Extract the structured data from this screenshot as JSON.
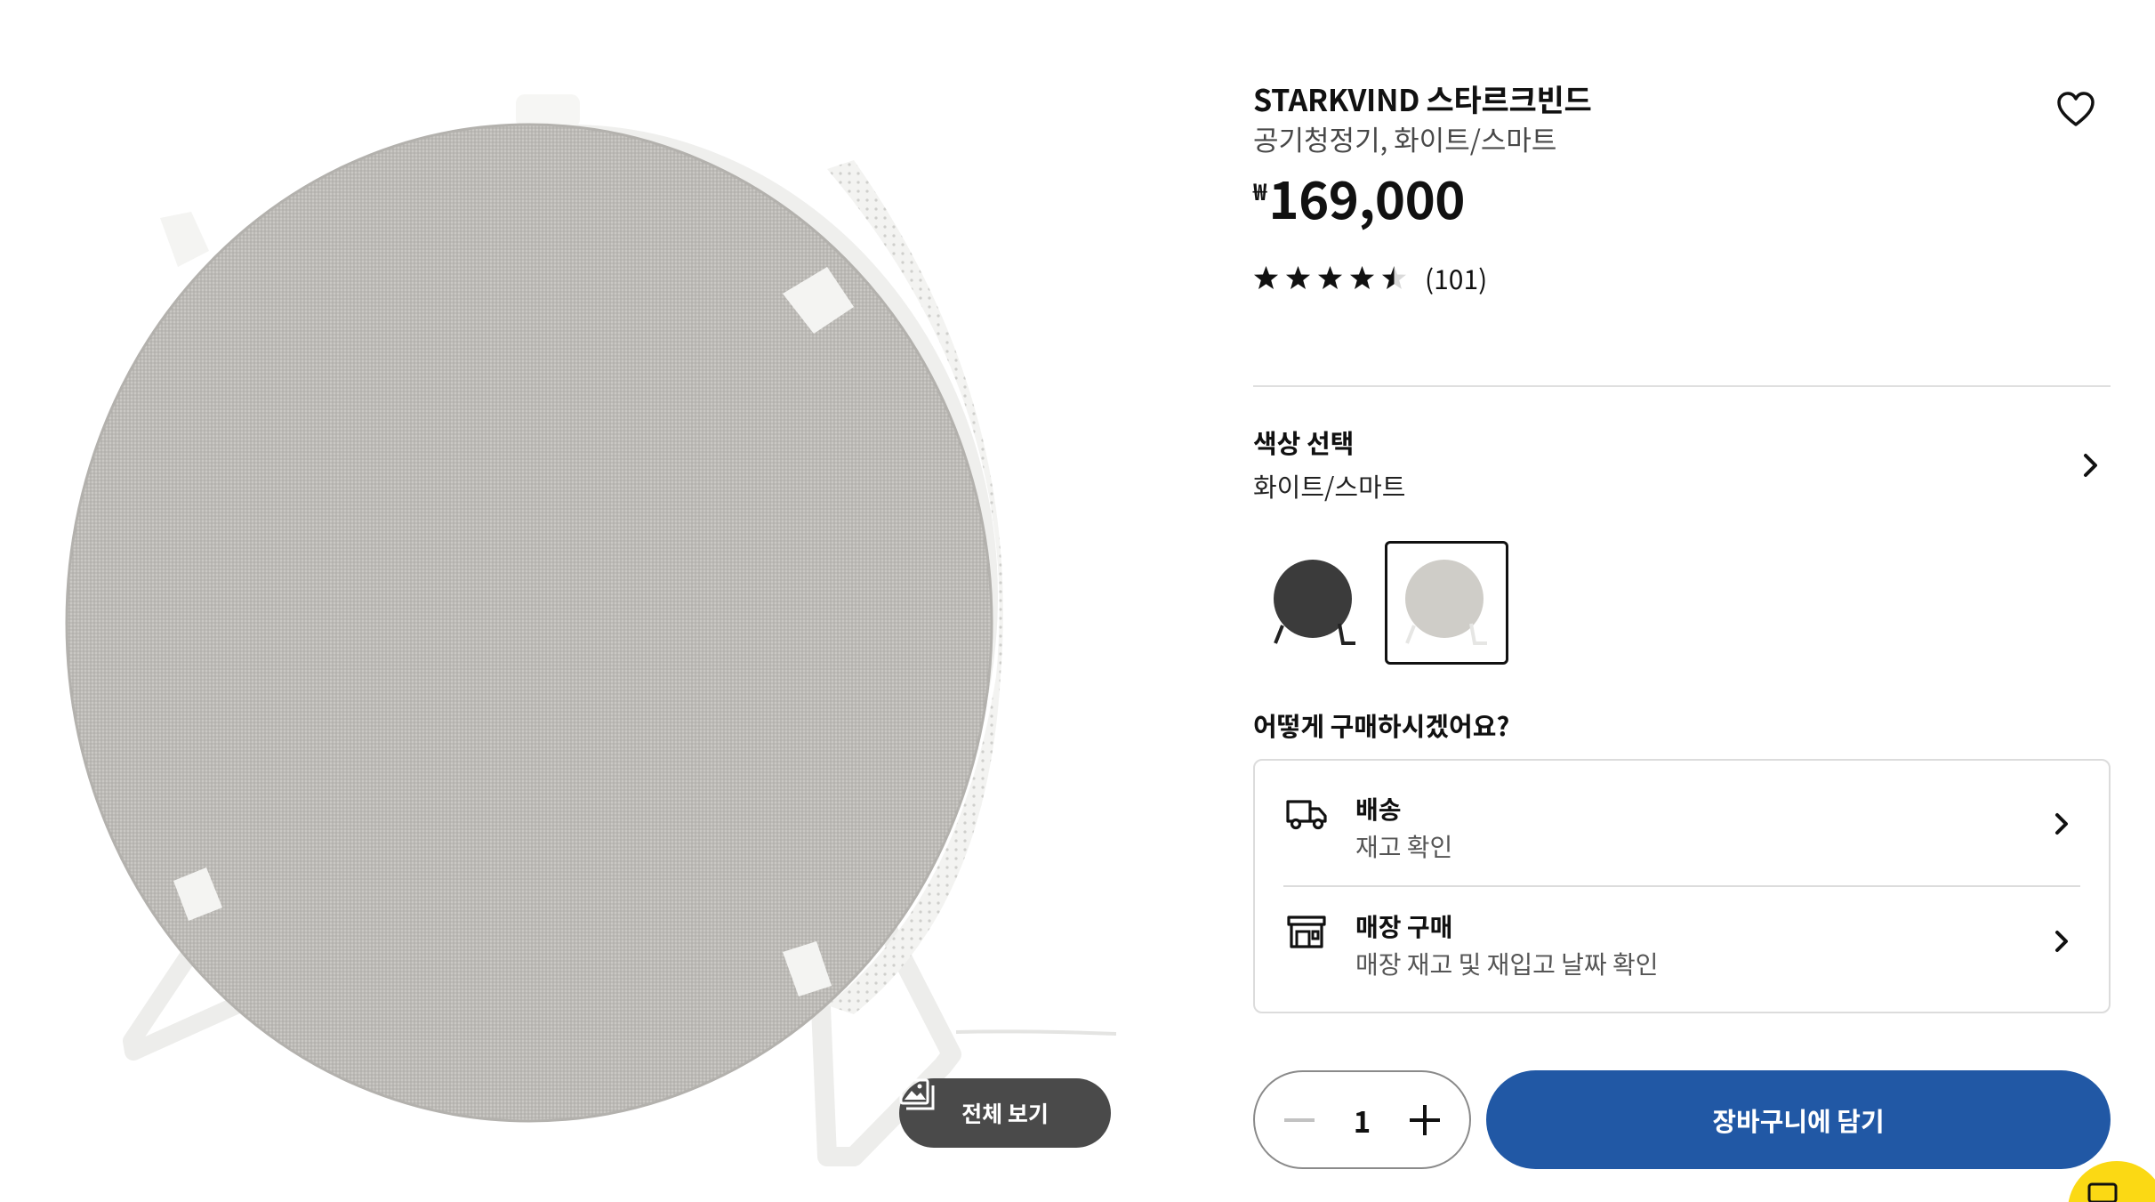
{
  "product": {
    "title": "STARKVIND 스타르크빈드",
    "subtitle": "공기청정기, 화이트/스마트",
    "currency": "₩",
    "price": "169,000",
    "rating_value": 4.5,
    "rating_max": 5,
    "review_count": "(101)"
  },
  "gallery": {
    "view_all_label": "전체 보기"
  },
  "color": {
    "heading": "색상 선택",
    "selected": "화이트/스마트",
    "swatches": [
      {
        "name": "dark-grey",
        "color": "#3b3b3b"
      },
      {
        "name": "white",
        "color": "#cfcdc8"
      }
    ]
  },
  "purchase": {
    "heading": "어떻게 구매하시겠어요?",
    "options": [
      {
        "title": "배송",
        "subtitle": "재고 확인",
        "icon": "truck-icon"
      },
      {
        "title": "매장 구매",
        "subtitle": "매장 재고 및 재입고 날짜 확인",
        "icon": "store-icon"
      }
    ]
  },
  "cart": {
    "quantity": "1",
    "add_to_cart_label": "장바구니에 담기"
  },
  "colors": {
    "accent": "#2158a5",
    "chat_bubble": "#fbd914",
    "view_all_bg": "#4a4a4a"
  }
}
